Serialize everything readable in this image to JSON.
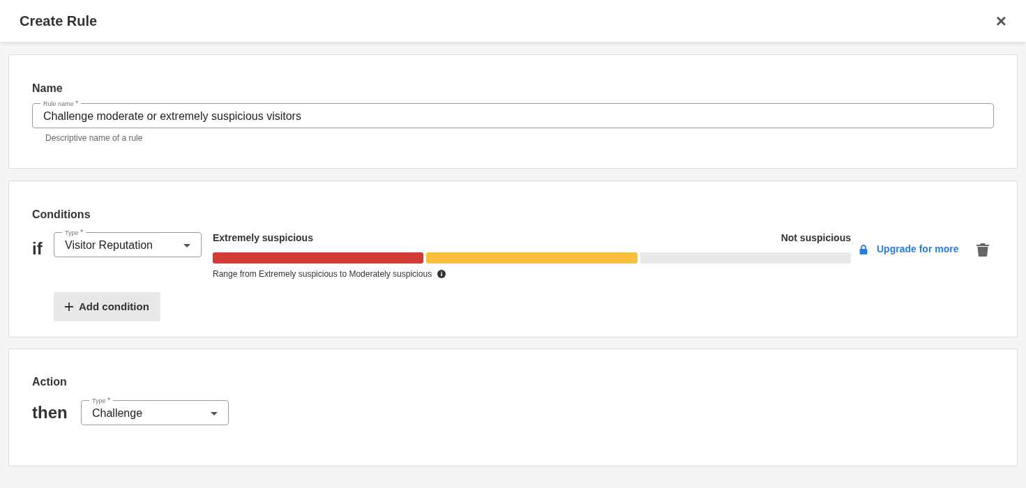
{
  "dialog": {
    "title": "Create Rule",
    "close": "×"
  },
  "name_section": {
    "heading": "Name",
    "field": {
      "label": "Rule name",
      "mark": "*",
      "value": "Challenge moderate or extremely suspicious visitors",
      "helper": "Descriptive name of a rule"
    }
  },
  "conditions_section": {
    "heading": "Conditions",
    "keyword": "if",
    "type_field": {
      "label": "Type",
      "mark": "*",
      "value": "Visitor Reputation"
    },
    "range": {
      "left_label": "Extremely suspicious",
      "right_label": "Not suspicious",
      "caption": "Range from Extremely suspicious to Moderately suspicious",
      "segments": [
        {
          "color": "#d43b37"
        },
        {
          "color": "#fbbf40"
        },
        {
          "color": "#e6e9e8"
        }
      ]
    },
    "upgrade_link": "Upgrade for more",
    "add_button": "Add condition"
  },
  "action_section": {
    "heading": "Action",
    "keyword": "then",
    "type_field": {
      "label": "Type",
      "mark": "*",
      "value": "Challenge"
    }
  }
}
